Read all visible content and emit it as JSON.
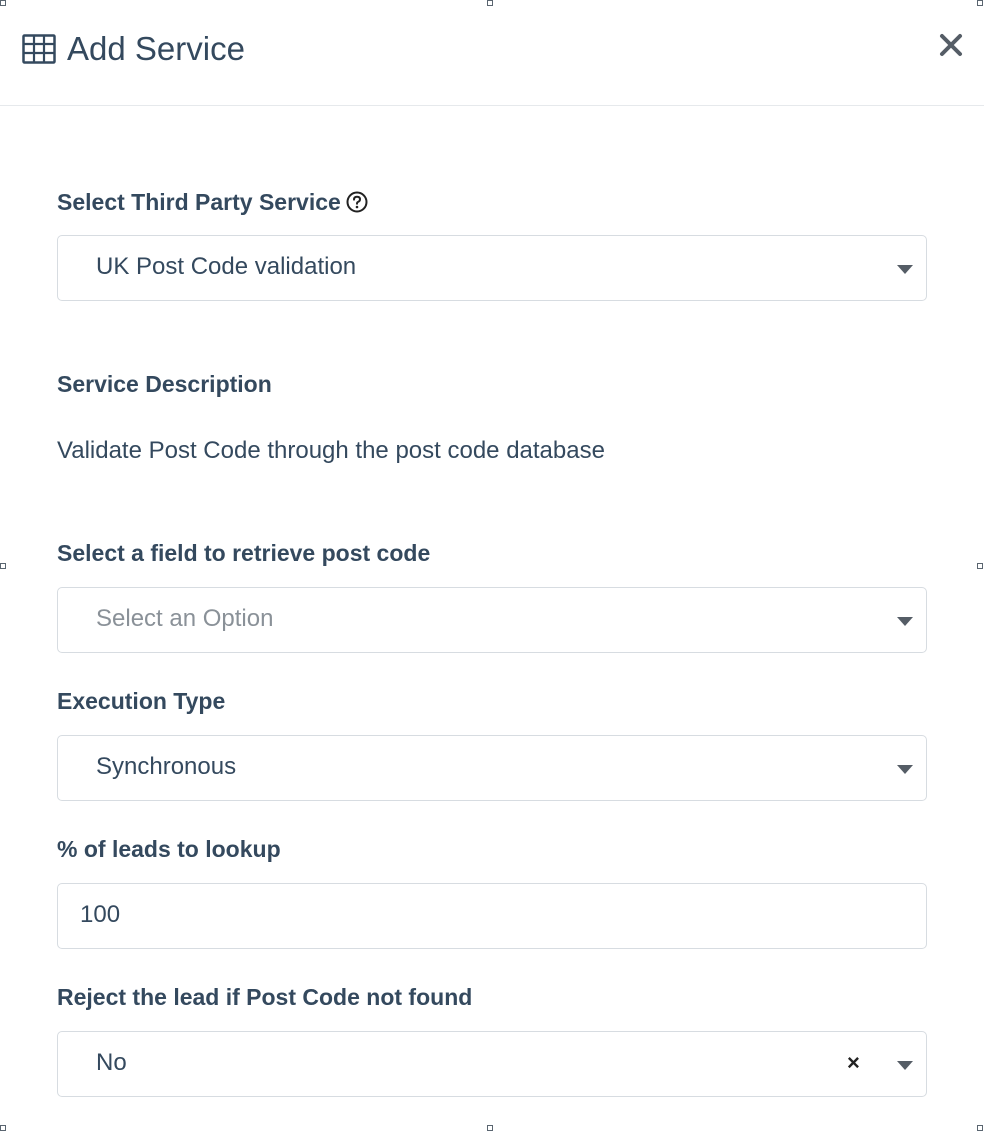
{
  "dialog": {
    "title": "Add Service",
    "title_icon": "table-icon",
    "close_icon": "close-icon"
  },
  "fields": {
    "third_party_service": {
      "label": "Select Third Party Service",
      "help_icon": "question-circle-icon",
      "value": "UK Post Code validation"
    },
    "service_description": {
      "label": "Service Description",
      "text": "Validate Post Code through the post code database"
    },
    "post_code_field": {
      "label": "Select a field to retrieve post code",
      "placeholder": "Select an Option"
    },
    "execution_type": {
      "label": "Execution Type",
      "value": "Synchronous"
    },
    "leads_percent": {
      "label": "% of leads to lookup",
      "value": "100"
    },
    "reject_lead": {
      "label": "Reject the lead if Post Code not found",
      "value": "No",
      "clear_symbol": "×"
    }
  },
  "colors": {
    "text": "#34495e",
    "border": "#d7dce1",
    "placeholder": "#8a9198"
  }
}
